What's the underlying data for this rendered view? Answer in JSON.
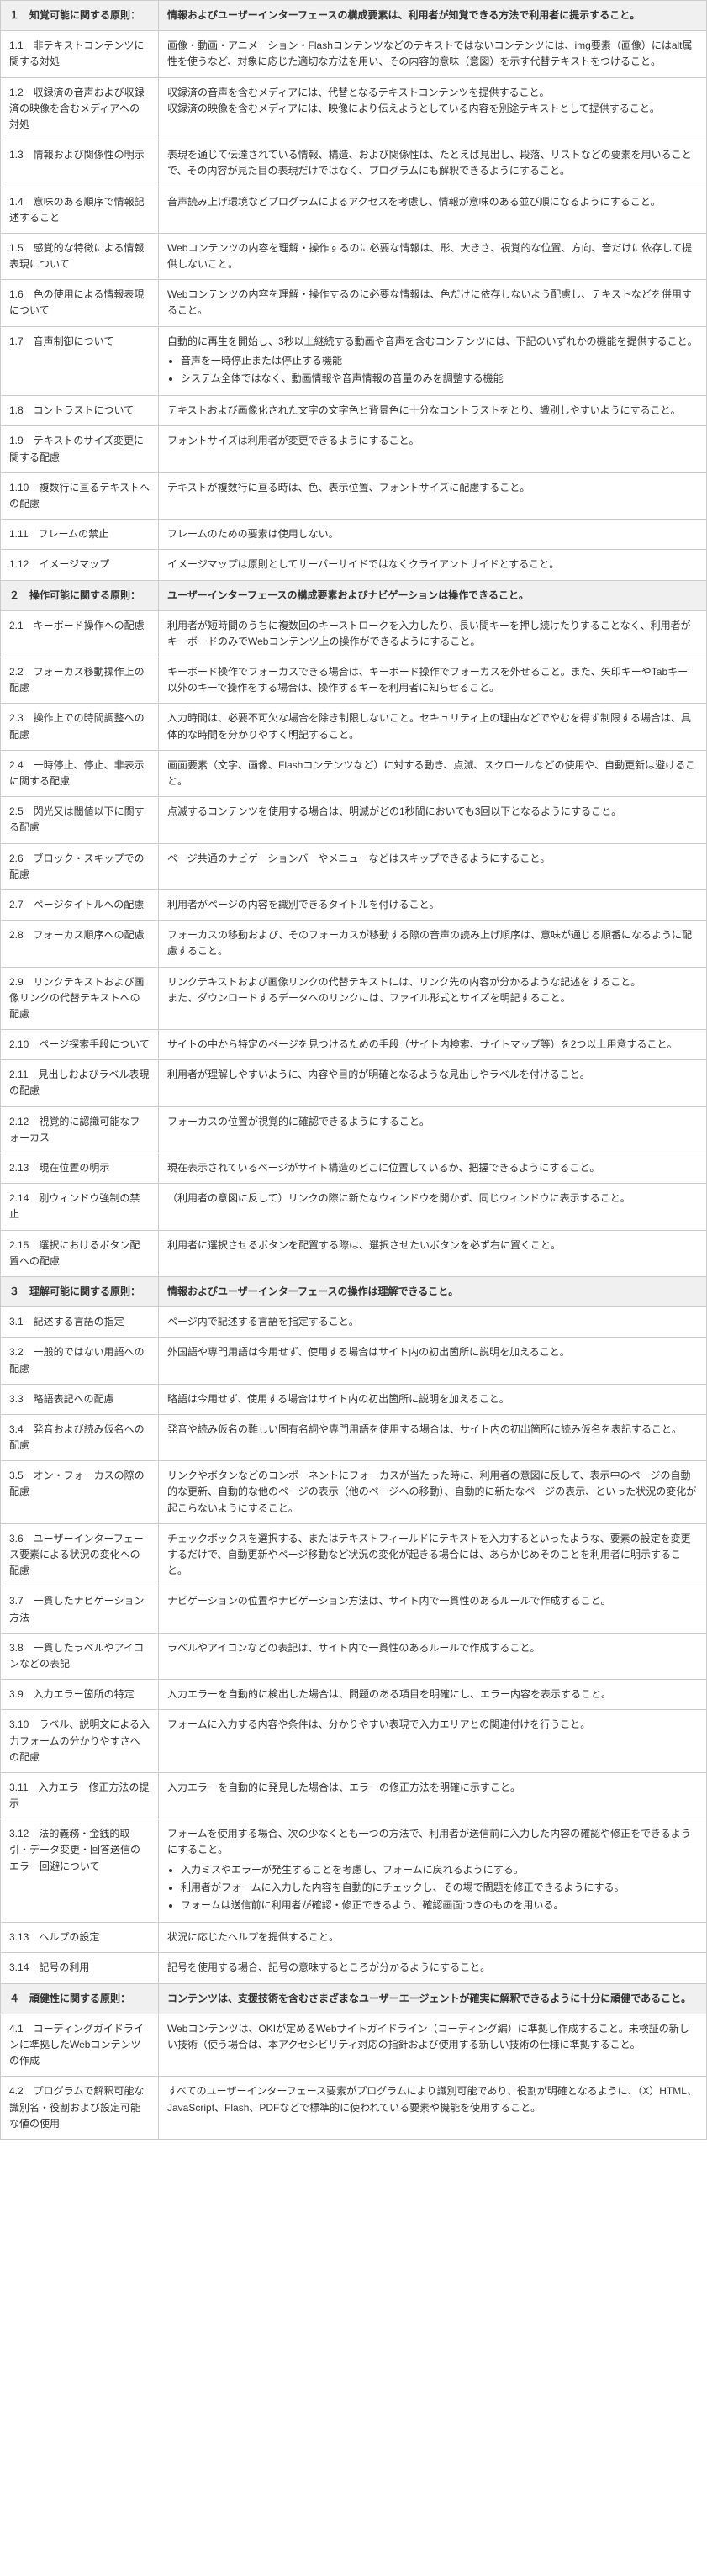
{
  "rows": [
    {
      "type": "section",
      "id": "１　知覚可能に関する原則：",
      "desc": "情報およびユーザーインターフェースの構成要素は、利用者が知覚できる方法で利用者に提示すること。"
    },
    {
      "type": "item",
      "id": "1.1　非テキストコンテンツに関する対処",
      "desc": "画像・動画・アニメーション・Flashコンテンツなどのテキストではないコンテンツには、img要素（画像）にはalt属性を使うなど、対象に応じた適切な方法を用い、その内容的意味（意図）を示す代替テキストをつけること。"
    },
    {
      "type": "item",
      "id": "1.2　収録済の音声および収録済の映像を含むメディアへの対処",
      "desc": "収録済の音声を含むメディアには、代替となるテキストコンテンツを提供すること。\n収録済の映像を含むメディアには、映像により伝えようとしている内容を別途テキストとして提供すること。"
    },
    {
      "type": "item",
      "id": "1.3　情報および関係性の明示",
      "desc": "表現を通じて伝達されている情報、構造、および関係性は、たとえば見出し、段落、リストなどの要素を用いることで、その内容が見た目の表現だけではなく、プログラムにも解釈できるようにすること。"
    },
    {
      "type": "item",
      "id": "1.4　意味のある順序で情報記述すること",
      "desc": "音声読み上げ環境などプログラムによるアクセスを考慮し、情報が意味のある並び順になるようにすること。"
    },
    {
      "type": "item",
      "id": "1.5　感覚的な特徴による情報表現について",
      "desc": "Webコンテンツの内容を理解・操作するのに必要な情報は、形、大きさ、視覚的な位置、方向、音だけに依存して提供しないこと。"
    },
    {
      "type": "item",
      "id": "1.6　色の使用による情報表現について",
      "desc": "Webコンテンツの内容を理解・操作するのに必要な情報は、色だけに依存しないよう配慮し、テキストなどを併用すること。"
    },
    {
      "type": "item-bullets",
      "id": "1.7　音声制御について",
      "desc": "自動的に再生を開始し、3秒以上継続する動画や音声を含むコンテンツには、下記のいずれかの機能を提供すること。",
      "bullets": [
        "音声を一時停止または停止する機能",
        "システム全体ではなく、動画情報や音声情報の音量のみを調整する機能"
      ]
    },
    {
      "type": "item",
      "id": "1.8　コントラストについて",
      "desc": "テキストおよび画像化された文字の文字色と背景色に十分なコントラストをとり、識別しやすいようにすること。"
    },
    {
      "type": "item",
      "id": "1.9　テキストのサイズ変更に関する配慮",
      "desc": "フォントサイズは利用者が変更できるようにすること。"
    },
    {
      "type": "item",
      "id": "1.10　複数行に亘るテキストへの配慮",
      "desc": "テキストが複数行に亘る時は、色、表示位置、フォントサイズに配慮すること。"
    },
    {
      "type": "item",
      "id": "1.11　フレームの禁止",
      "desc": "フレームのための要素は使用しない。"
    },
    {
      "type": "item",
      "id": "1.12　イメージマップ",
      "desc": "イメージマップは原則としてサーバーサイドではなくクライアントサイドとすること。"
    },
    {
      "type": "section",
      "id": "２　操作可能に関する原則：",
      "desc": "ユーザーインターフェースの構成要素およびナビゲーションは操作できること。"
    },
    {
      "type": "item",
      "id": "2.1　キーボード操作への配慮",
      "desc": "利用者が短時間のうちに複数回のキーストロークを入力したり、長い間キーを押し続けたりすることなく、利用者がキーボードのみでWebコンテンツ上の操作ができるようにすること。"
    },
    {
      "type": "item",
      "id": "2.2　フォーカス移動操作上の配慮",
      "desc": "キーボード操作でフォーカスできる場合は、キーボード操作でフォーカスを外せること。また、矢印キーやTabキー以外のキーで操作をする場合は、操作するキーを利用者に知らせること。"
    },
    {
      "type": "item",
      "id": "2.3　操作上での時間調整への配慮",
      "desc": "入力時間は、必要不可欠な場合を除き制限しないこと。セキュリティ上の理由などでやむを得ず制限する場合は、具体的な時間を分かりやすく明記すること。"
    },
    {
      "type": "item",
      "id": "2.4　一時停止、停止、非表示に関する配慮",
      "desc": "画面要素（文字、画像、Flashコンテンツなど）に対する動き、点滅、スクロールなどの使用や、自動更新は避けること。"
    },
    {
      "type": "item",
      "id": "2.5　閃光又は閾値以下に関する配慮",
      "desc": "点滅するコンテンツを使用する場合は、明滅がどの1秒間においても3回以下となるようにすること。"
    },
    {
      "type": "item",
      "id": "2.6　ブロック・スキップでの配慮",
      "desc": "ページ共通のナビゲーションバーやメニューなどはスキップできるようにすること。"
    },
    {
      "type": "item",
      "id": "2.7　ページタイトルへの配慮",
      "desc": "利用者がページの内容を識別できるタイトルを付けること。"
    },
    {
      "type": "item",
      "id": "2.8　フォーカス順序への配慮",
      "desc": "フォーカスの移動および、そのフォーカスが移動する際の音声の読み上げ順序は、意味が通じる順番になるように配慮すること。"
    },
    {
      "type": "item",
      "id": "2.9　リンクテキストおよび画像リンクの代替テキストへの配慮",
      "desc": "リンクテキストおよび画像リンクの代替テキストには、リンク先の内容が分かるような記述をすること。\nまた、ダウンロードするデータへのリンクには、ファイル形式とサイズを明記すること。"
    },
    {
      "type": "item",
      "id": "2.10　ページ探索手段について",
      "desc": "サイトの中から特定のページを見つけるための手段（サイト内検索、サイトマップ等）を2つ以上用意すること。"
    },
    {
      "type": "item",
      "id": "2.11　見出しおよびラベル表現の配慮",
      "desc": "利用者が理解しやすいように、内容や目的が明確となるような見出しやラベルを付けること。"
    },
    {
      "type": "item",
      "id": "2.12　視覚的に認識可能なフォーカス",
      "desc": "フォーカスの位置が視覚的に確認できるようにすること。"
    },
    {
      "type": "item",
      "id": "2.13　現在位置の明示",
      "desc": "現在表示されているページがサイト構造のどこに位置しているか、把握できるようにすること。"
    },
    {
      "type": "item",
      "id": "2.14　別ウィンドウ強制の禁止",
      "desc": "（利用者の意図に反して）リンクの際に新たなウィンドウを開かず、同じウィンドウに表示すること。"
    },
    {
      "type": "item",
      "id": "2.15　選択におけるボタン配置への配慮",
      "desc": "利用者に選択させるボタンを配置する際は、選択させたいボタンを必ず右に置くこと。"
    },
    {
      "type": "section",
      "id": "３　理解可能に関する原則：",
      "desc": "情報およびユーザーインターフェースの操作は理解できること。"
    },
    {
      "type": "item",
      "id": "3.1　記述する言語の指定",
      "desc": "ページ内で記述する言語を指定すること。"
    },
    {
      "type": "item",
      "id": "3.2　一般的ではない用語への配慮",
      "desc": "外国語や専門用語は今用せず、使用する場合はサイト内の初出箇所に説明を加えること。"
    },
    {
      "type": "item",
      "id": "3.3　略語表記への配慮",
      "desc": "略語は今用せず、使用する場合はサイト内の初出箇所に説明を加えること。"
    },
    {
      "type": "item",
      "id": "3.4　発音および読み仮名への配慮",
      "desc": "発音や読み仮名の難しい固有名詞や専門用語を使用する場合は、サイト内の初出箇所に読み仮名を表記すること。"
    },
    {
      "type": "item",
      "id": "3.5　オン・フォーカスの際の配慮",
      "desc": "リンクやボタンなどのコンポーネントにフォーカスが当たった時に、利用者の意図に反して、表示中のページの自動的な更新、自動的な他のページの表示（他のページへの移動）、自動的に新たなページの表示、といった状況の変化が起こらないようにすること。"
    },
    {
      "type": "item",
      "id": "3.6　ユーザーインターフェース要素による状況の変化への配慮",
      "desc": "チェックボックスを選択する、またはテキストフィールドにテキストを入力するといったような、要素の設定を変更するだけで、自動更新やページ移動など状況の変化が起きる場合には、あらかじめそのことを利用者に明示すること。"
    },
    {
      "type": "item",
      "id": "3.7　一貫したナビゲーション方法",
      "desc": "ナビゲーションの位置やナビゲーション方法は、サイト内で一貫性のあるルールで作成すること。"
    },
    {
      "type": "item",
      "id": "3.8　一貫したラベルやアイコンなどの表記",
      "desc": "ラベルやアイコンなどの表記は、サイト内で一貫性のあるルールで作成すること。"
    },
    {
      "type": "item",
      "id": "3.9　入力エラー箇所の特定",
      "desc": "入力エラーを自動的に検出した場合は、問題のある項目を明確にし、エラー内容を表示すること。"
    },
    {
      "type": "item",
      "id": "3.10　ラベル、説明文による入力フォームの分かりやすさへの配慮",
      "desc": "フォームに入力する内容や条件は、分かりやすい表現で入力エリアとの関連付けを行うこと。"
    },
    {
      "type": "item",
      "id": "3.11　入力エラー修正方法の提示",
      "desc": "入力エラーを自動的に発見した場合は、エラーの修正方法を明確に示すこと。"
    },
    {
      "type": "item-bullets",
      "id": "3.12　法的義務・金銭的取引・データ変更・回答送信のエラー回避について",
      "desc": "フォームを使用する場合、次の少なくとも一つの方法で、利用者が送信前に入力した内容の確認や修正をできるようにすること。",
      "bullets": [
        "入力ミスやエラーが発生することを考慮し、フォームに戻れるようにする。",
        "利用者がフォームに入力した内容を自動的にチェックし、その場で問題を修正できるようにする。",
        "フォームは送信前に利用者が確認・修正できるよう、確認画面つきのものを用いる。"
      ]
    },
    {
      "type": "item",
      "id": "3.13　ヘルプの設定",
      "desc": "状況に応じたヘルプを提供すること。"
    },
    {
      "type": "item",
      "id": "3.14　記号の利用",
      "desc": "記号を使用する場合、記号の意味するところが分かるようにすること。"
    },
    {
      "type": "section",
      "id": "４　頑健性に関する原則：",
      "desc": "コンテンツは、支援技術を含むさまざまなユーザーエージェントが確実に解釈できるように十分に頑健であること。"
    },
    {
      "type": "item",
      "id": "4.1　コーディングガイドラインに準拠したWebコンテンツの作成",
      "desc": "Webコンテンツは、OKIが定めるWebサイトガイドライン（コーディング編）に準拠し作成すること。未検証の新しい技術（使う場合は、本アクセシビリティ対応の指針および使用する新しい技術の仕様に準拠すること。"
    },
    {
      "type": "item",
      "id": "4.2　プログラムで解釈可能な識別名・役割および設定可能な値の使用",
      "desc": "すべてのユーザーインターフェース要素がプログラムにより識別可能であり、役割が明確となるように、（X）HTML、JavaScript、Flash、PDFなどで標準的に使われている要素や機能を使用すること。"
    }
  ]
}
